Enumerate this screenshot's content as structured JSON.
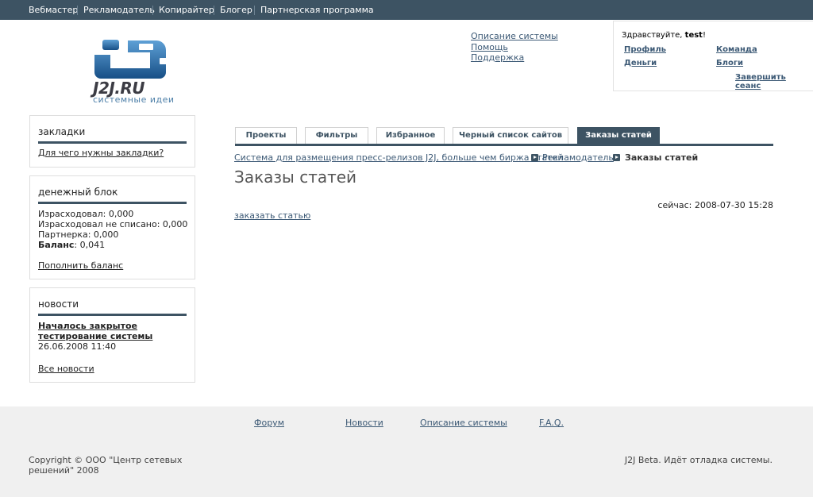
{
  "topnav": {
    "items": [
      "Вебмастер",
      "Рекламодатель",
      "Копирайтер",
      "Блогер",
      "Партнерская программа"
    ]
  },
  "logo": {
    "wordmark": "J2J.RU",
    "tagline": "системные идеи"
  },
  "header_links": [
    "Описание системы",
    "Помощь",
    "Поддержка"
  ],
  "userbox": {
    "greeting_prefix": "Здравствуйте, ",
    "username": "test",
    "greeting_suffix": "!",
    "links": {
      "profile": "Профиль",
      "team": "Команда",
      "money": "Деньги",
      "blogs": "Блоги",
      "logout": "Завершить сеанс"
    }
  },
  "sidebar": {
    "bookmarks": {
      "title": "закладки",
      "link": "Для чего нужны закладки?"
    },
    "money": {
      "title": "денежный блок",
      "spent": "Израсходовал: 0,000",
      "spent_unwritten": "Израсходовал не списано: 0,000",
      "partner": "Партнерка: 0,000",
      "balance_label": "Баланс",
      "balance_value": ": 0,041",
      "topup": "Пополнить баланс"
    },
    "news": {
      "title": "новости",
      "headline": "Началось закрытое тестирование системы",
      "date": "26.06.2008 11:40",
      "all": "Все новости"
    }
  },
  "tabs": [
    {
      "label": "Проекты",
      "active": false
    },
    {
      "label": "Фильтры",
      "active": false
    },
    {
      "label": "Избранное",
      "active": false
    },
    {
      "label": "Черный список сайтов",
      "active": false
    },
    {
      "label": "Заказы статей",
      "active": true
    }
  ],
  "breadcrumb": {
    "root": "Система для размещения пресс-релизов J2J, больше чем биржа статей",
    "section": "Рекламодатель",
    "current": "Заказы статей"
  },
  "main": {
    "title": "Заказы статей",
    "now": "сейчас: 2008-07-30 15:28",
    "order_link": "заказать статью"
  },
  "footer": {
    "links": [
      "Форум",
      "Новости",
      "Описание системы",
      "F.A.Q."
    ],
    "copyright": "Copyright © ООО \"Центр сетевых решений\" 2008",
    "beta": "J2J Beta. Идёт отладка системы."
  },
  "colors": {
    "nav_bg": "#3d5363",
    "accent": "#3d5363",
    "link": "#3d5a76",
    "logo_blue": "#1f5f9a",
    "footer_bg": "#f0f0f0"
  }
}
